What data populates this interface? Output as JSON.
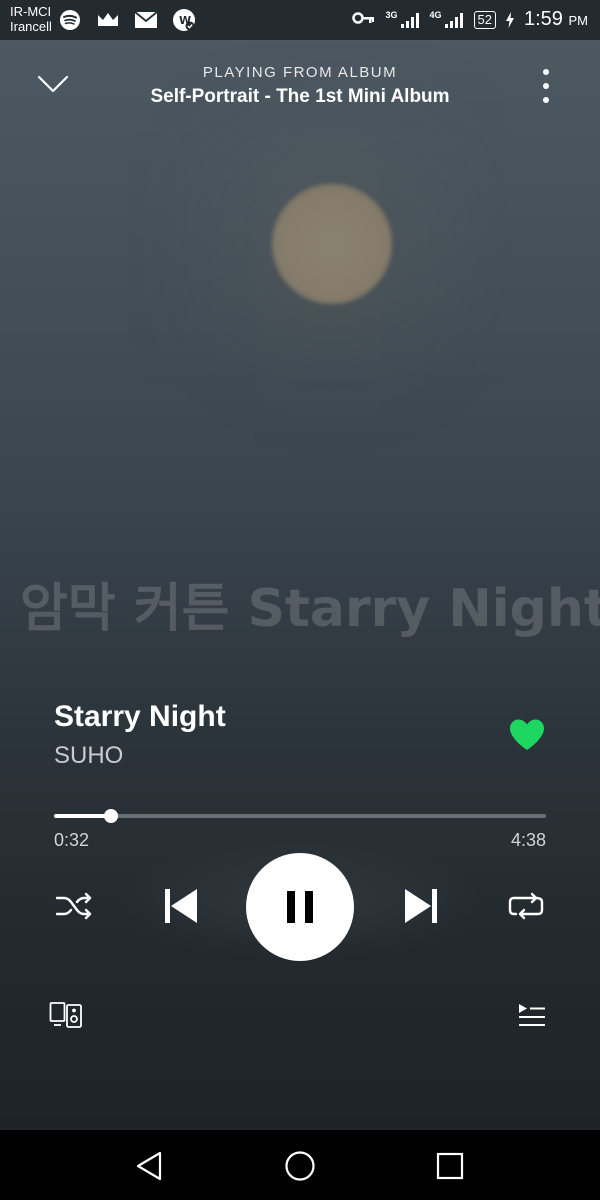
{
  "status_bar": {
    "carrier_line1": "IR-MCI",
    "carrier_line2": "Irancell",
    "network_1": "3G",
    "network_2": "4G",
    "battery": "52",
    "time": "1:59",
    "ampm": "PM",
    "icons": [
      "spotify-icon",
      "crown-icon",
      "mail-icon",
      "app-icon",
      "key-icon",
      "signal-icon",
      "signal-icon",
      "battery-icon",
      "charging-icon"
    ]
  },
  "header": {
    "subtitle": "PLAYING FROM ALBUM",
    "album": "Self-Portrait - The 1st Mini Album"
  },
  "artwork": {
    "overlay_text": "암막 커튼 Starry Night"
  },
  "track": {
    "title": "Starry Night",
    "artist": "SUHO",
    "liked": true
  },
  "progress": {
    "elapsed": "0:32",
    "total": "4:38",
    "fraction": 0.115
  },
  "colors": {
    "accent": "#1ed760",
    "background_top": "#4d5a63",
    "background_bottom": "#1e2327"
  }
}
